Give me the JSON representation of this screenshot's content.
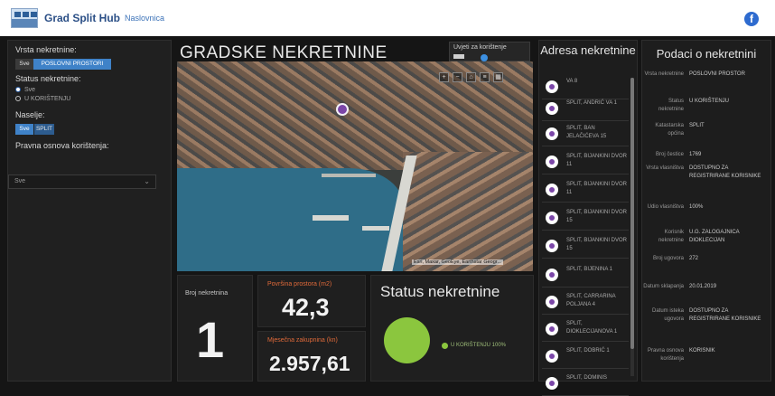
{
  "header": {
    "title": "Grad Split Hub",
    "nav_link": "Naslovnica"
  },
  "filters": {
    "vrsta_label": "Vrsta nekretnine:",
    "vrsta_options": [
      "Sve",
      "POSLOVNI PROSTORI"
    ],
    "status_label": "Status nekretnine:",
    "status_options": [
      "Sve",
      "U KORIŠTENJU"
    ],
    "naselje_label": "Naselje:",
    "naselje_options": [
      "Sve",
      "SPLIT"
    ],
    "pravna_label": "Pravna osnova korištenja:",
    "pravna_value": "Sve"
  },
  "main": {
    "title": "GRADSKE NEKRETNINE",
    "legend_label": "Uvjeti za korištenje"
  },
  "map": {
    "attribution": "Esri, Maxar, GeoEye, Earthstar Geogr..."
  },
  "stats": {
    "count_label": "Broj nekretnina",
    "count_value": "1",
    "area_label": "Površina prostora (m2)",
    "area_value": "42,3",
    "rent_label": "Mjesečna zakupnina (kn)",
    "rent_value": "2.957,61"
  },
  "status_chart": {
    "title": "Status nekretnine",
    "legend": "U KORIŠTENJU 100%"
  },
  "chart_data": {
    "type": "pie",
    "title": "Status nekretnine",
    "categories": [
      "U KORIŠTENJU"
    ],
    "values": [
      100
    ]
  },
  "addresses": {
    "title": "Adresa nekretnine",
    "items": [
      "VA 8",
      "SPLIT, ANDRIĆ VA 1",
      "SPLIT, BAN JELAČIĆEVA 15",
      "SPLIT, BIJANKINI DVOR 11",
      "SPLIT, BIJANKINI DVOR 11",
      "SPLIT, BIJANKINI DVOR 15",
      "SPLIT, BIJANKINI DVOR 15",
      "SPLIT, BIJENINA 1",
      "SPLIT, CARRARINA POLJANA 4",
      "SPLIT, DIOKLECIJANOVA 1",
      "SPLIT, DOBRIĆ 1",
      "SPLIT, DOMINIS"
    ]
  },
  "details": {
    "title": "Podaci o nekretnini",
    "rows": [
      {
        "key": "Vrsta nekretnine",
        "value": "POSLOVNI PROSTOR"
      },
      {
        "key": "Status nekretnine",
        "value": "U KORIŠTENJU"
      },
      {
        "key": "Katastarska općina",
        "value": "SPLIT"
      },
      {
        "key": "Broj čestice",
        "value": "1769"
      },
      {
        "key": "Vrsta vlasništva",
        "value": "DOSTUPNO ZA REGISTRIRANE KORISNIKE"
      },
      {
        "key": "Udio vlasništva",
        "value": "100%"
      },
      {
        "key": "Korisnik nekretnine",
        "value": "U.G. ZALOGAJNICA DIOKLECIJAN"
      },
      {
        "key": "Broj ugovora",
        "value": "272"
      },
      {
        "key": "Datum sklapanja",
        "value": "20.01.2019"
      },
      {
        "key": "Datum isteka ugovora",
        "value": "DOSTUPNO ZA REGISTRIRANE KORISNIKE"
      },
      {
        "key": "Pravna osnova korištenja",
        "value": "KORISNIK"
      }
    ]
  }
}
